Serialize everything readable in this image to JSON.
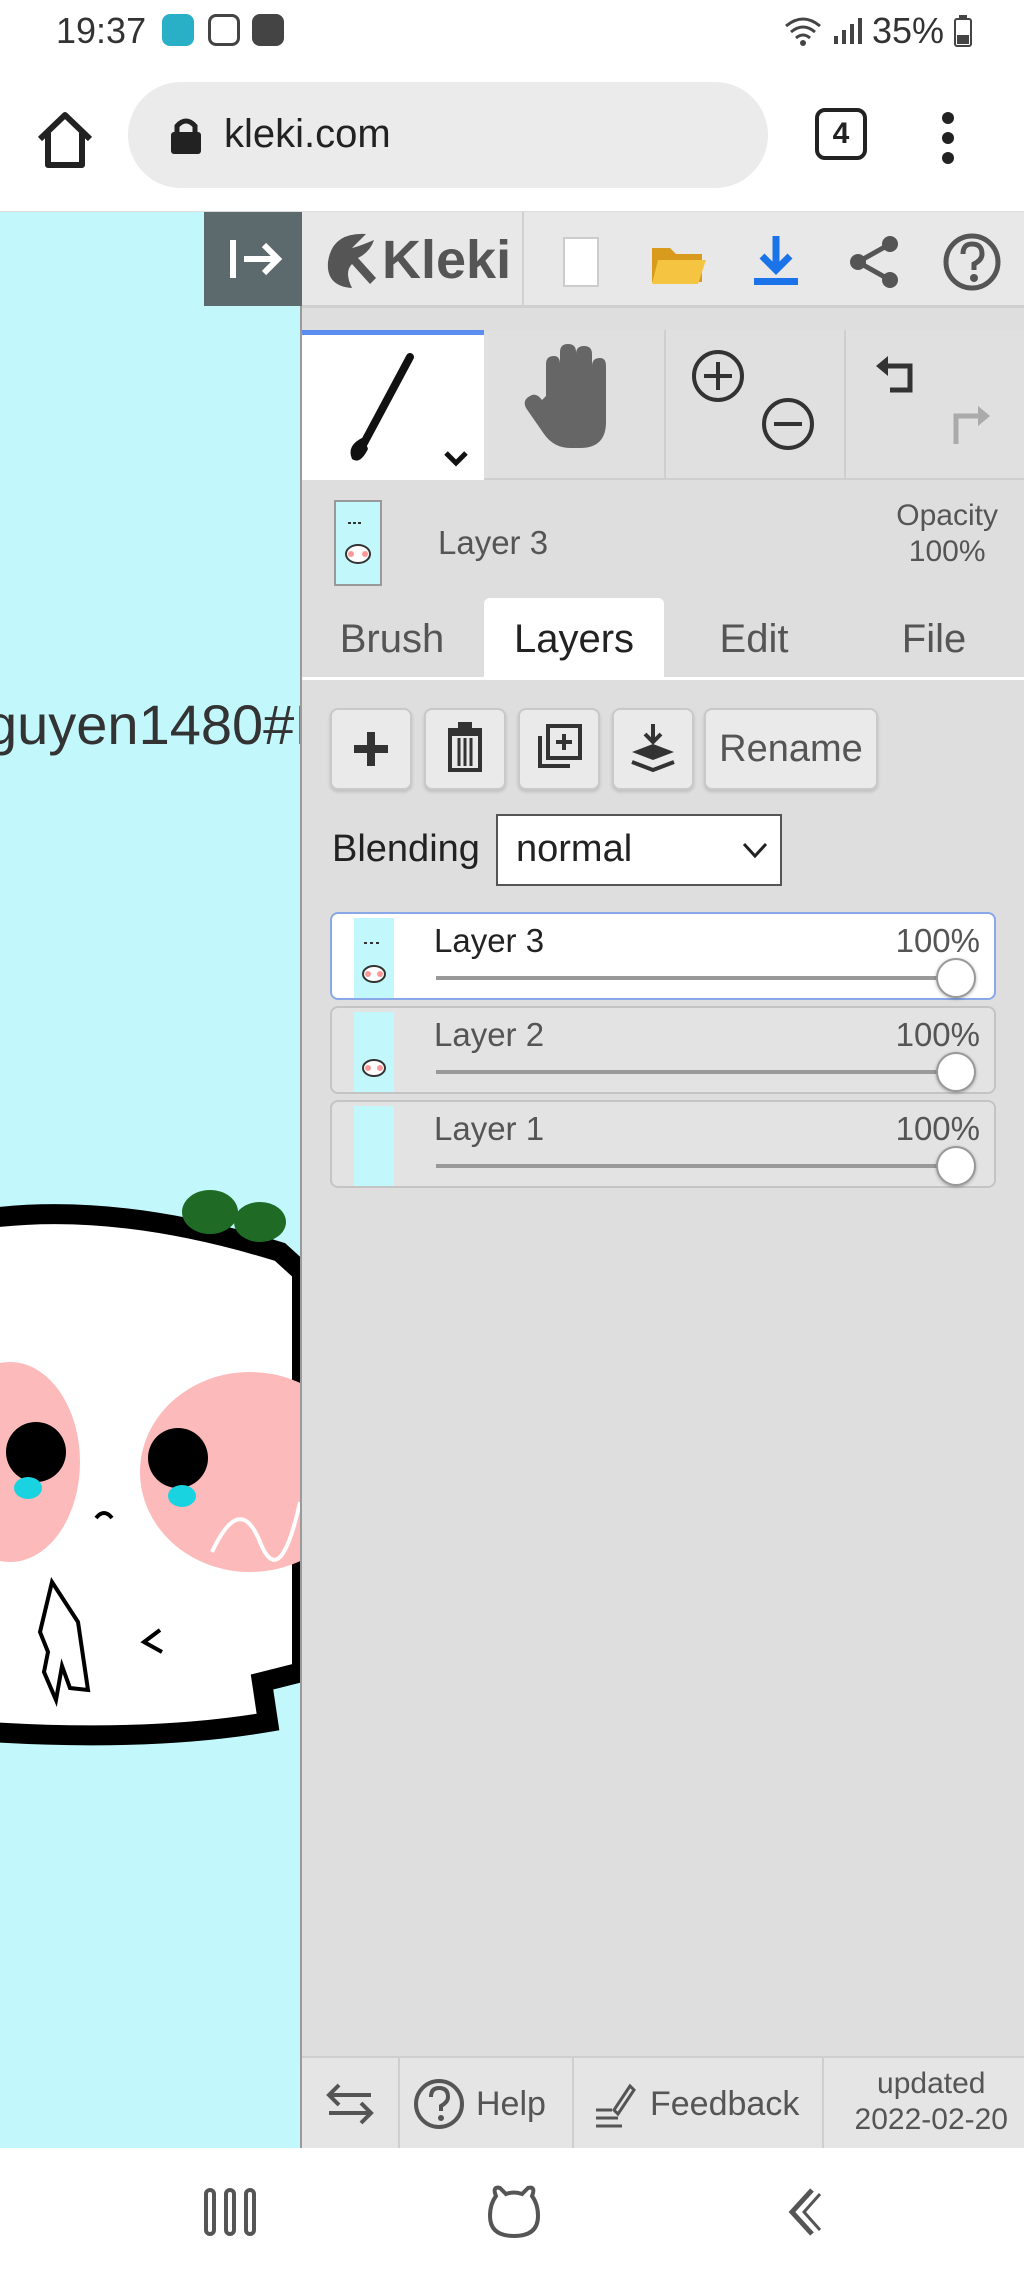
{
  "status": {
    "time": "19:37",
    "battery": "35%",
    "app_icons": [
      "messenger-icon",
      "instagram-icon",
      "baomoi-icon"
    ]
  },
  "browser": {
    "url": "kleki.com",
    "tab_count": "4"
  },
  "canvas": {
    "text": "guyen1480#I",
    "bg_color": "#c2f8fc"
  },
  "app": {
    "name": "Kleki"
  },
  "current_layer": {
    "name": "Layer 3",
    "opacity_label": "Opacity",
    "opacity_value": "100%"
  },
  "tabs": [
    {
      "label": "Brush",
      "active": false
    },
    {
      "label": "Layers",
      "active": true
    },
    {
      "label": "Edit",
      "active": false
    },
    {
      "label": "File",
      "active": false
    }
  ],
  "actions": {
    "rename_label": "Rename"
  },
  "blending": {
    "label": "Blending",
    "value": "normal"
  },
  "layers": [
    {
      "name": "Layer 3",
      "opacity": "100%",
      "opacity_fraction": 1.0,
      "active": true
    },
    {
      "name": "Layer 2",
      "opacity": "100%",
      "opacity_fraction": 1.0,
      "active": false
    },
    {
      "name": "Layer 1",
      "opacity": "100%",
      "opacity_fraction": 1.0,
      "active": false
    }
  ],
  "footer": {
    "help": "Help",
    "feedback": "Feedback",
    "updated_label": "updated",
    "updated_date": "2022-02-20"
  },
  "colors": {
    "accent": "#5b8ef0",
    "download": "#1a73e8",
    "folder": "#f5b82e"
  }
}
